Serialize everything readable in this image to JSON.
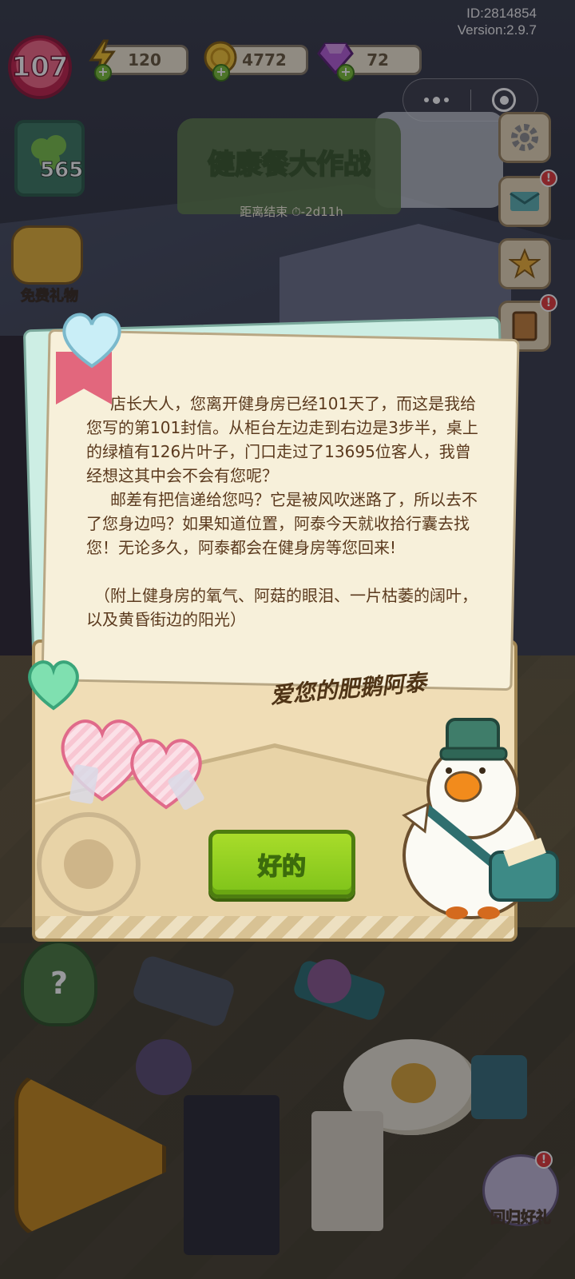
{
  "hud": {
    "id_text": "ID:2814854",
    "version_text": "Version:2.9.7",
    "level": "107",
    "energy": "120",
    "coins": "4772",
    "gems": "72",
    "clover_count": "565",
    "event_title": "健康餐大作战",
    "event_timer": "距离结束 ⏱-2d11h",
    "free_gift_label": "免费礼物",
    "return_gift_label": "回归好礼",
    "help_symbol": "?"
  },
  "letter": {
    "paragraphs": [
      "店长大人，您离开健身房已经101天了，而这是我给您写的第101封信。从柜台左边走到右边是3步半，桌上的绿植有126片叶子，门口走过了13695位客人，我曾经想这其中会不会有您呢？",
      "邮差有把信递给您吗？它是被风吹迷路了，所以去不了您身边吗？如果知道位置，阿泰今天就收拾行囊去找您！无论多久，阿泰都会在健身房等您回来!"
    ],
    "postscript": "（附上健身房的氧气、阿菇的眼泪、一片枯萎的阔叶，以及黄昏街边的阳光）",
    "signature": "爱您的肥鹅阿泰",
    "ok_button": "好的"
  },
  "colors": {
    "level_badge": "#e8476a",
    "ok_button": "#8fcf22",
    "letter_text": "#5b3a1e",
    "paper": "#f7f0da",
    "envelope": "#f0ddb6"
  }
}
